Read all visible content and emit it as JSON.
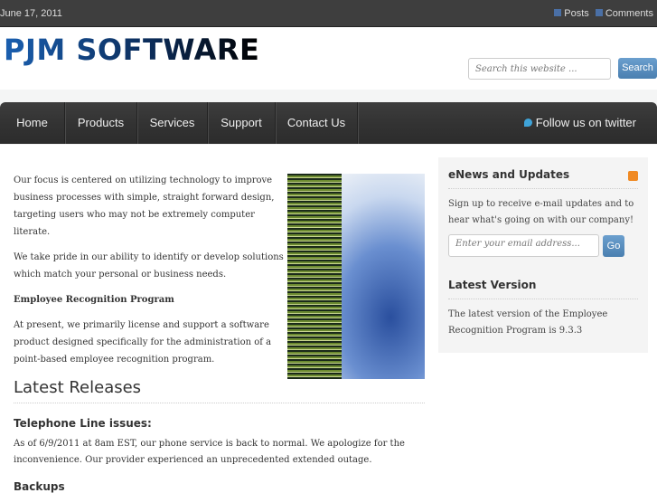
{
  "topbar": {
    "date": "June 17, 2011",
    "posts": "Posts",
    "comments": "Comments"
  },
  "header": {
    "logo": "PJM SOFTWARE",
    "search_placeholder": "Search this website ...",
    "search_button": "Search"
  },
  "nav": {
    "items": [
      "Home",
      "Products",
      "Services",
      "Support",
      "Contact Us"
    ],
    "twitter": "Follow us on twitter"
  },
  "main": {
    "p1": "Our focus is centered on utilizing technology to improve business processes with simple, straight forward design, targeting users who may not be extremely computer literate.",
    "p2": "We take pride in our ability to identify or develop solutions which match your personal or business needs.",
    "heading": "Employee Recognition Program",
    "p3": "At present, we primarily license and support a software product designed specifically for the administration of a point-based employee recognition program."
  },
  "releases": {
    "title": "Latest Releases",
    "item1_title": "Telephone Line issues:",
    "item1_text": "As of 6/9/2011 at 8am EST, our phone service is back to normal. We apologize for the inconvenience. Our provider experienced an unprecedented extended outage.",
    "item2_title": "Backups"
  },
  "sidebar": {
    "enews_title": "eNews and Updates",
    "enews_text": "Sign up to receive e-mail updates and to hear what's going on with our company!",
    "email_placeholder": "Enter your email address...",
    "go": "Go",
    "version_title": "Latest Version",
    "version_text": "The latest version of the Employee Recognition Program is 9.3.3"
  }
}
